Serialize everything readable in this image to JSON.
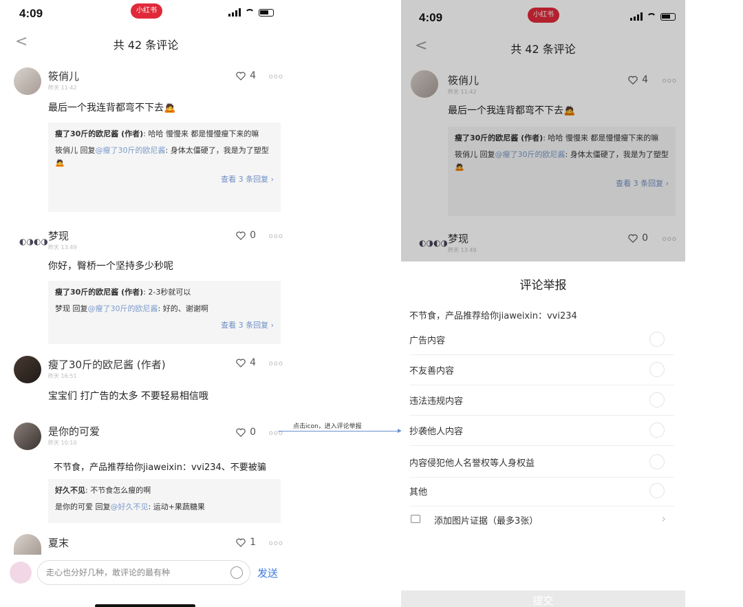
{
  "status": {
    "time": "4:09",
    "brand": "小红书"
  },
  "nav": {
    "back": "<",
    "title": "共 42 条评论"
  },
  "comments": [
    {
      "name": "筱俏儿",
      "time": "昨天 11:42",
      "likes": "4",
      "text": "最后一个我连背都弯不下去🙇",
      "replies": [
        {
          "author": "瘦了30斤的欧尼酱 (作者)",
          "sep": ": ",
          "text": "哈哈 慢慢来 都是慢慢瘦下来的嘛"
        },
        {
          "author": "筱俏儿",
          "mid": " 回复",
          "mention": "@瘦了30斤的欧尼酱",
          "text": ": 身体太僵硬了，我是为了塑型🙇"
        }
      ],
      "view_more": "查看 3 条回复 ›"
    },
    {
      "name": "梦现",
      "time": "昨天 13:49",
      "likes": "0",
      "text": "你好，臀桥一个坚持多少秒呢",
      "replies": [
        {
          "author": "瘦了30斤的欧尼酱 (作者)",
          "sep": ": ",
          "text": "2-3秒就可以"
        },
        {
          "author": "梦现",
          "mid": " 回复",
          "mention": "@瘦了30斤的欧尼酱",
          "text": ": 好的、谢谢啊"
        }
      ],
      "view_more": "查看 3 条回复 ›"
    },
    {
      "name": "瘦了30斤的欧尼酱 (作者)",
      "time": "昨天 16:51",
      "likes": "4",
      "text": "宝宝们 打广告的太多 不要轻易相信哦"
    },
    {
      "name": "是你的可爱",
      "time": "昨天 10:10",
      "likes": "0",
      "text": "不节食，产品推荐给你jiaweixin：vvi234、不要被骗",
      "replies": [
        {
          "author": "好久不见",
          "sep": ": ",
          "text": "不节食怎么瘦的啊"
        },
        {
          "author": "是你的可爱",
          "mid": " 回复",
          "mention": "@好久不见",
          "text": ": 运动+果蔬糖果"
        }
      ]
    },
    {
      "name": "夏末",
      "likes": "1"
    }
  ],
  "input": {
    "placeholder": "走心也分好几种，敢评论的最有种",
    "send": "发送"
  },
  "annotation": "点击icon，进入评论举报",
  "right": {
    "comment1": {
      "name": "筱俏儿",
      "time": "昨天 11:42",
      "likes": "4",
      "text": "最后一个我连背都弯不下去🙇",
      "reply1_author": "瘦了30斤的欧尼酱 (作者)",
      "reply1_text": ": 哈哈 慢慢来 都是慢慢瘦下来的嘛",
      "reply2_author": "筱俏儿",
      "reply2_mid": " 回复",
      "reply2_mention": "@瘦了30斤的欧尼酱",
      "reply2_text": ": 身体太僵硬了，我是为了塑型🙇",
      "view_more": "查看 3 条回复 ›"
    },
    "comment2": {
      "name": "梦现",
      "time": "昨天 13:49",
      "likes": "0"
    },
    "sheet": {
      "title": "评论举报",
      "quoted": "不节食，产品推荐给你jiaweixin：vvi234",
      "options": [
        "广告内容",
        "不友善内容",
        "违法违规内容",
        "抄袭他人内容",
        "内容侵犯他人名誉权等人身权益",
        "其他"
      ],
      "add_image": "添加图片证据（最多3张）",
      "submit": "提交"
    }
  },
  "colors": {
    "brand": "#e02a3a",
    "link": "#6d8ec4",
    "send": "#3d7be0"
  },
  "icons": [
    "back-icon",
    "heart-icon",
    "more-icon",
    "emoji-icon",
    "image-icon",
    "chevron-right-icon"
  ]
}
